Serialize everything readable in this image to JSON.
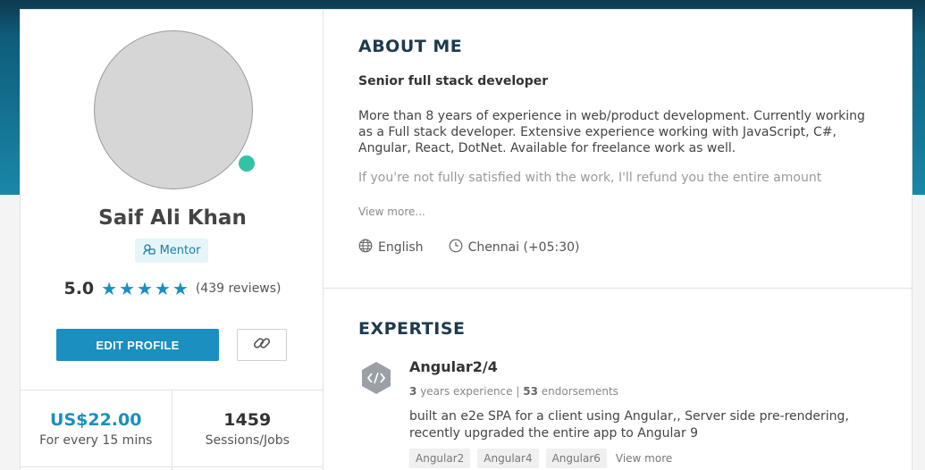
{
  "profile": {
    "name": "Saif Ali Khan",
    "badge": "Mentor",
    "rating": "5.0",
    "stars": 5,
    "reviews": "(439 reviews)",
    "edit_button": "EDIT PROFILE"
  },
  "stats": {
    "price": "US$22.00",
    "price_label": "For every 15 mins",
    "sessions": "1459",
    "sessions_label": "Sessions/Jobs"
  },
  "about": {
    "title": "ABOUT ME",
    "headline": "Senior full stack developer",
    "bio": "More than 8 years of experience in web/product development. Currently working as a Full stack developer. Extensive experience working with JavaScript, C#, Angular, React, DotNet. Available for freelance work as well.",
    "bio_faded": "If you're not fully satisfied with the work, I'll refund you the entire amount",
    "view_more": "View more...",
    "language": "English",
    "location": "Chennai (+05:30)"
  },
  "expertise": {
    "title": "EXPERTISE",
    "skills": [
      {
        "name": "Angular2/4",
        "years": "3",
        "years_label": "years experience",
        "endorsements": "53",
        "endorsements_label": "endorsements",
        "description": "built an e2e SPA for a client using Angular,, Server side pre-rendering, recently upgraded the entire app to Angular 9",
        "tags": [
          "Angular2",
          "Angular4",
          "Angular6"
        ],
        "more": "View more"
      }
    ]
  },
  "colors": {
    "accent": "#1a8fc0",
    "header_dark": "#0e3a4e",
    "online": "#33c2a6"
  },
  "icons": [
    "mentor-icon",
    "star-icon",
    "link-icon",
    "globe-icon",
    "clock-icon",
    "code-icon"
  ]
}
